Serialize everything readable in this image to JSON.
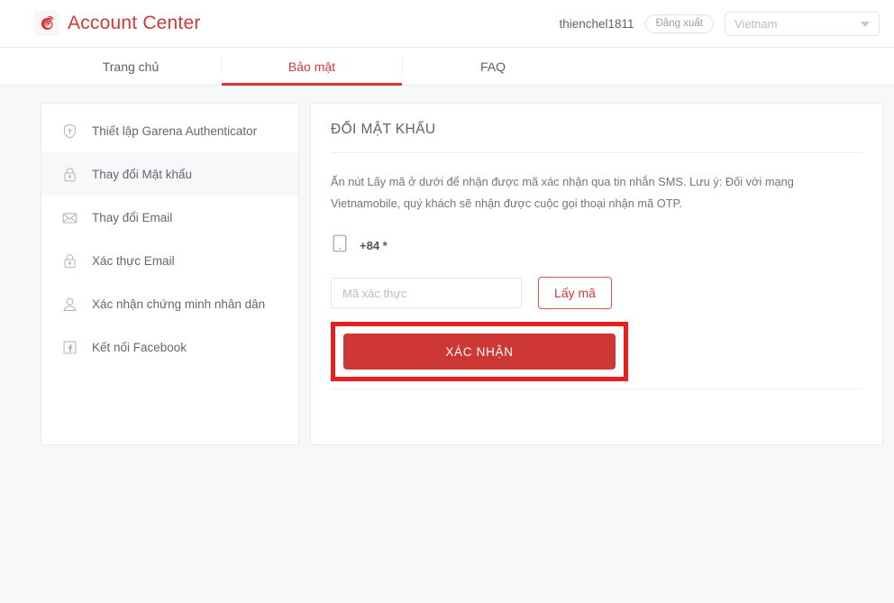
{
  "header": {
    "brand_title": "Account Center",
    "logo_icon": "garena-logo-icon",
    "username": "thienchel1811",
    "logout_label": "Đăng xuất",
    "country_value": "Vietnam",
    "caret_icon": "chevron-down-icon"
  },
  "tabs": [
    {
      "label": "Trang chủ",
      "active": false
    },
    {
      "label": "Bảo mật",
      "active": true
    },
    {
      "label": "FAQ",
      "active": false
    }
  ],
  "sidebar": {
    "items": [
      {
        "label": "Thiết lập Garena Authenticator",
        "icon": "shield-icon",
        "active": false
      },
      {
        "label": "Thay đổi Mật khẩu",
        "icon": "lock-icon",
        "active": true
      },
      {
        "label": "Thay đổi Email",
        "icon": "envelope-icon",
        "active": false
      },
      {
        "label": "Xác thực Email",
        "icon": "lock-icon",
        "active": false
      },
      {
        "label": "Xác nhận chứng minh nhân dân",
        "icon": "person-icon",
        "active": false
      },
      {
        "label": "Kết nối Facebook",
        "icon": "facebook-icon",
        "active": false
      }
    ]
  },
  "content": {
    "title": "ĐỔI MẬT KHẨU",
    "description": "Ấn nút Lấy mã ở dưới để nhận được mã xác nhận qua tin nhắn SMS. Lưu ý: Đối với mạng Vietnamobile, quý khách sẽ nhận được cuộc gọi thoại nhận mã OTP.",
    "phone_icon": "mobile-phone-icon",
    "phone_prefix": "+84 *",
    "code_input_value": "",
    "code_input_placeholder": "Mã xác thực",
    "get_code_label": "Lấy mã",
    "submit_label": "XÁC NHẬN"
  },
  "colors": {
    "brand_red": "#d0393a",
    "submit_red": "#cd3835",
    "highlight_red": "#e8201d",
    "page_background": "#f7f8fa",
    "text_gray": "#616872"
  }
}
